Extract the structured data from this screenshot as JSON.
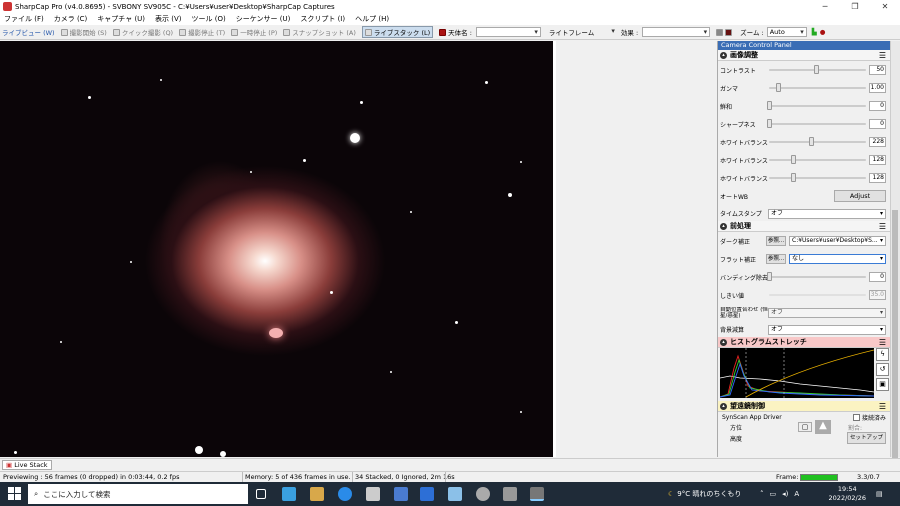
{
  "window": {
    "title": "SharpCap Pro (v4.0.8695) - SVBONY SV905C - C:¥Users¥user¥Desktop¥SharpCap Captures"
  },
  "menu": [
    "ファイル (F)",
    "カメラ (C)",
    "キャプチャ (U)",
    "表示 (V)",
    "ツール (O)",
    "シーケンサー (U)",
    "スクリプト (I)",
    "ヘルプ (H)"
  ],
  "toolbar": {
    "live_view": "ライブビュー (W)",
    "start_capture": "撮影開始 (S)",
    "quick_capture": "クイック撮影 (Q)",
    "stop_capture": "撮影停止 (T)",
    "pause": "一時停止 (P)",
    "snapshot": "スナップショット (A)",
    "live_stack": "ライブスタック (L)",
    "target_label": "天体名 :",
    "target_value": "",
    "frame_type": "ライトフレーム",
    "effect_label": "効果 :",
    "effect_value": "",
    "zoom_label": "ズーム :",
    "zoom_value": "Auto"
  },
  "panel": {
    "title": "Camera Control Panel",
    "image_adjust": {
      "header": "画像調整",
      "rows": [
        {
          "label": "コントラスト",
          "value": "50",
          "pos": 0.5
        },
        {
          "label": "ガンマ",
          "value": "1.00",
          "pos": 0.08
        },
        {
          "label": "鮮和",
          "value": "0",
          "pos": 0.0
        },
        {
          "label": "シャープネス",
          "value": "0",
          "pos": 0.0
        },
        {
          "label": "ホワイトバランス(R)",
          "value": "228",
          "pos": 0.45
        },
        {
          "label": "ホワイトバランス(G)",
          "value": "128",
          "pos": 0.25
        },
        {
          "label": "ホワイトバランス(B)",
          "value": "128",
          "pos": 0.25
        }
      ],
      "auto_wb_label": "オートWB",
      "adjust_button": "Adjust",
      "timestamp_label": "タイムスタンプ",
      "timestamp_value": "オフ"
    },
    "preprocess": {
      "header": "前処理",
      "dark_label": "ダーク補正",
      "dark_browse": "参照...",
      "dark_value": "C:¥Users¥user¥Desktop¥S...",
      "flat_label": "フラット補正",
      "flat_browse": "参照...",
      "flat_value": "なし",
      "banding_label": "バンディング除去",
      "banding_value": "0",
      "threshold_label": "しきい値",
      "threshold_value": "35.0",
      "autostack_label": "自動位置合わせ (恒星/惑星)",
      "autostack_value": "オフ",
      "bg_label": "背景減算",
      "bg_value": "オフ"
    },
    "histogram": {
      "header": "ヒストグラムストレッチ"
    },
    "mount": {
      "header": "望遠鏡制御",
      "driver": "SynScan App Driver",
      "tracking": "接続済み",
      "ra": "方位",
      "alt": "高度",
      "rate": "割合:",
      "setup": "セットアップ"
    }
  },
  "livestack_tab": "Live Stack",
  "status": {
    "preview": "Previewing : 56 frames (0 dropped) in 0:03:44, 0.2 fps",
    "memory": "Memory: 5 of 436 frames in use.",
    "stacked": "34 Stacked, 0 Ignored, 2m 16s",
    "frame_label": "Frame:",
    "frame_value": "3.3/0.7",
    "frame_progress": 1.0
  },
  "taskbar": {
    "search_placeholder": "ここに入力して検索",
    "weather": "9°C  晴れのちくもり",
    "time": "19:54",
    "date": "2022/02/26",
    "ime": "A"
  }
}
